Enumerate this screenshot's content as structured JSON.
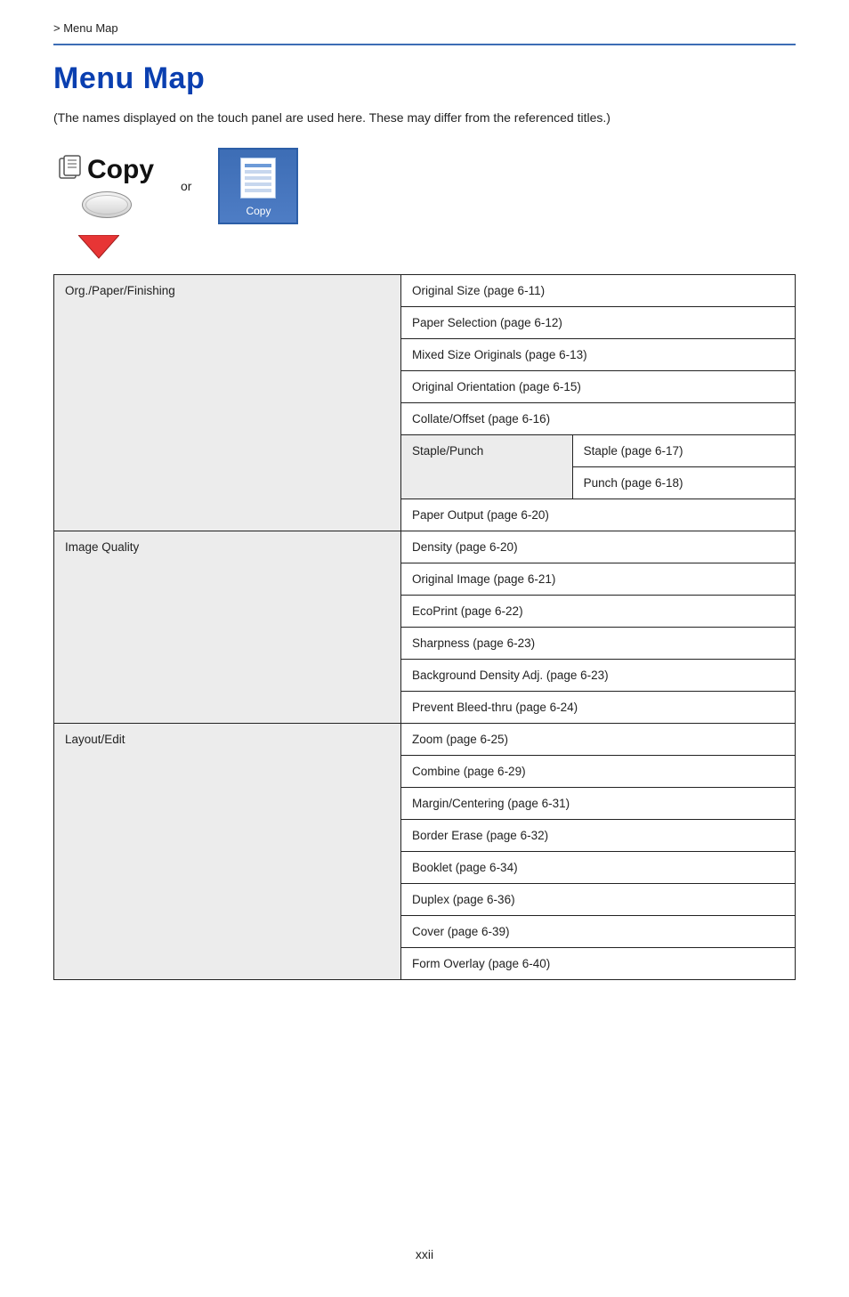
{
  "breadcrumb": " > Menu Map",
  "title": "Menu Map",
  "intro": "(The names displayed on the touch panel are used here. These may differ from the referenced titles.)",
  "copy_button_label": "Copy",
  "or_text": "or",
  "copy_tile_label": "Copy",
  "page_number": "xxii",
  "table": {
    "groups": [
      {
        "category": "Org./Paper/Finishing",
        "rows": [
          {
            "cells": [
              "Original Size (page 6-11)"
            ],
            "span": 2
          },
          {
            "cells": [
              "Paper Selection (page 6-12)"
            ],
            "span": 2
          },
          {
            "cells": [
              "Mixed Size Originals (page 6-13)"
            ],
            "span": 2
          },
          {
            "cells": [
              "Original Orientation (page 6-15)"
            ],
            "span": 2
          },
          {
            "cells": [
              "Collate/Offset (page 6-16)"
            ],
            "span": 2
          },
          {
            "cells": [
              "Staple/Punch",
              "Staple (page 6-17)"
            ],
            "sub_rowspan": 2
          },
          {
            "cells": [
              "Punch (page 6-18)"
            ]
          },
          {
            "cells": [
              "Paper Output (page 6-20)"
            ],
            "span": 2
          }
        ]
      },
      {
        "category": "Image Quality",
        "rows": [
          {
            "cells": [
              "Density (page 6-20)"
            ],
            "span": 2
          },
          {
            "cells": [
              "Original Image (page 6-21)"
            ],
            "span": 2
          },
          {
            "cells": [
              "EcoPrint (page 6-22)"
            ],
            "span": 2
          },
          {
            "cells": [
              "Sharpness (page 6-23)"
            ],
            "span": 2
          },
          {
            "cells": [
              "Background Density Adj. (page 6-23)"
            ],
            "span": 2
          },
          {
            "cells": [
              "Prevent Bleed-thru (page 6-24)"
            ],
            "span": 2
          }
        ]
      },
      {
        "category": "Layout/Edit",
        "rows": [
          {
            "cells": [
              "Zoom (page 6-25)"
            ],
            "span": 2
          },
          {
            "cells": [
              "Combine (page 6-29)"
            ],
            "span": 2
          },
          {
            "cells": [
              "Margin/Centering (page 6-31)"
            ],
            "span": 2
          },
          {
            "cells": [
              "Border Erase (page 6-32)"
            ],
            "span": 2
          },
          {
            "cells": [
              "Booklet (page 6-34)"
            ],
            "span": 2
          },
          {
            "cells": [
              "Duplex (page 6-36)"
            ],
            "span": 2
          },
          {
            "cells": [
              "Cover (page 6-39)"
            ],
            "span": 2
          },
          {
            "cells": [
              "Form Overlay (page 6-40)"
            ],
            "span": 2
          }
        ]
      }
    ]
  }
}
